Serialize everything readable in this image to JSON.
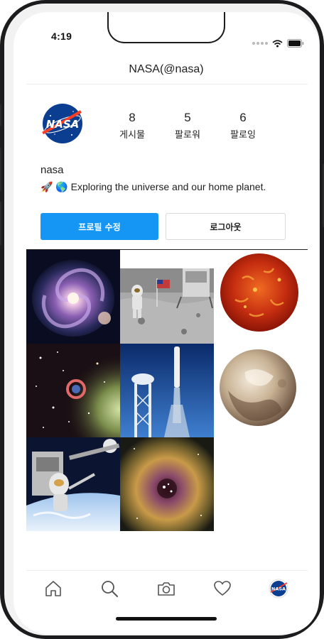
{
  "status_bar": {
    "time": "4:19"
  },
  "header": {
    "title": "NASA(@nasa)"
  },
  "profile": {
    "avatar": "nasa-logo",
    "username": "nasa",
    "bio": "🚀 🌎 Exploring the universe and our home planet.",
    "stats": [
      {
        "value": "8",
        "label": "게시물"
      },
      {
        "value": "5",
        "label": "팔로워"
      },
      {
        "value": "6",
        "label": "팔로잉"
      }
    ]
  },
  "buttons": {
    "edit_profile": "프로필 수정",
    "logout": "로그아웃"
  },
  "posts": [
    {
      "image": "spiral-galaxy"
    },
    {
      "image": "apollo-astronaut-moon"
    },
    {
      "image": "sun"
    },
    {
      "image": "star-field-nebula"
    },
    {
      "image": "rocket-launch"
    },
    {
      "image": "pluto"
    },
    {
      "image": "spacewalk-earth"
    },
    {
      "image": "rosette-nebula"
    }
  ],
  "tabbar": {
    "items": [
      {
        "icon": "home-icon"
      },
      {
        "icon": "search-icon"
      },
      {
        "icon": "camera-icon"
      },
      {
        "icon": "heart-icon"
      },
      {
        "icon": "profile-avatar-icon"
      }
    ]
  },
  "colors": {
    "primary_button": "#1596f5",
    "text": "#222222",
    "divider": "#ededed"
  }
}
